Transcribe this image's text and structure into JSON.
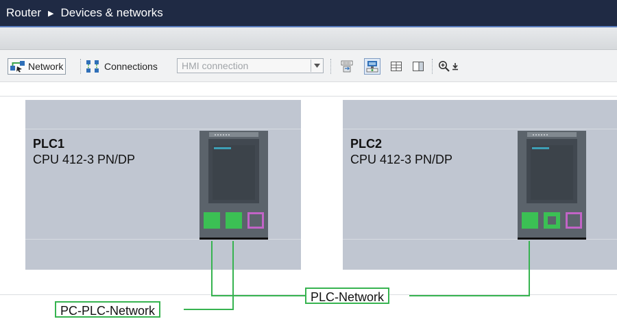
{
  "breadcrumb": {
    "root": "Router",
    "separator": "▶",
    "current": "Devices & networks"
  },
  "toolbar": {
    "network_label": "Network",
    "connections_label": "Connections",
    "connection_type_value": "HMI connection"
  },
  "devices": [
    {
      "name": "PLC1",
      "type": "CPU 412-3 PN/DP"
    },
    {
      "name": "PLC2",
      "type": "CPU 412-3 PN/DP"
    }
  ],
  "networks": {
    "plc_network": "PLC-Network",
    "pc_plc_network": "PC-PLC-Network"
  },
  "colors": {
    "titlebar": "#1f2a44",
    "subnet": "#36b34f",
    "port_active": "#3bc054",
    "port_idle": "#c264c7",
    "device_area": "#c0c6d1"
  }
}
